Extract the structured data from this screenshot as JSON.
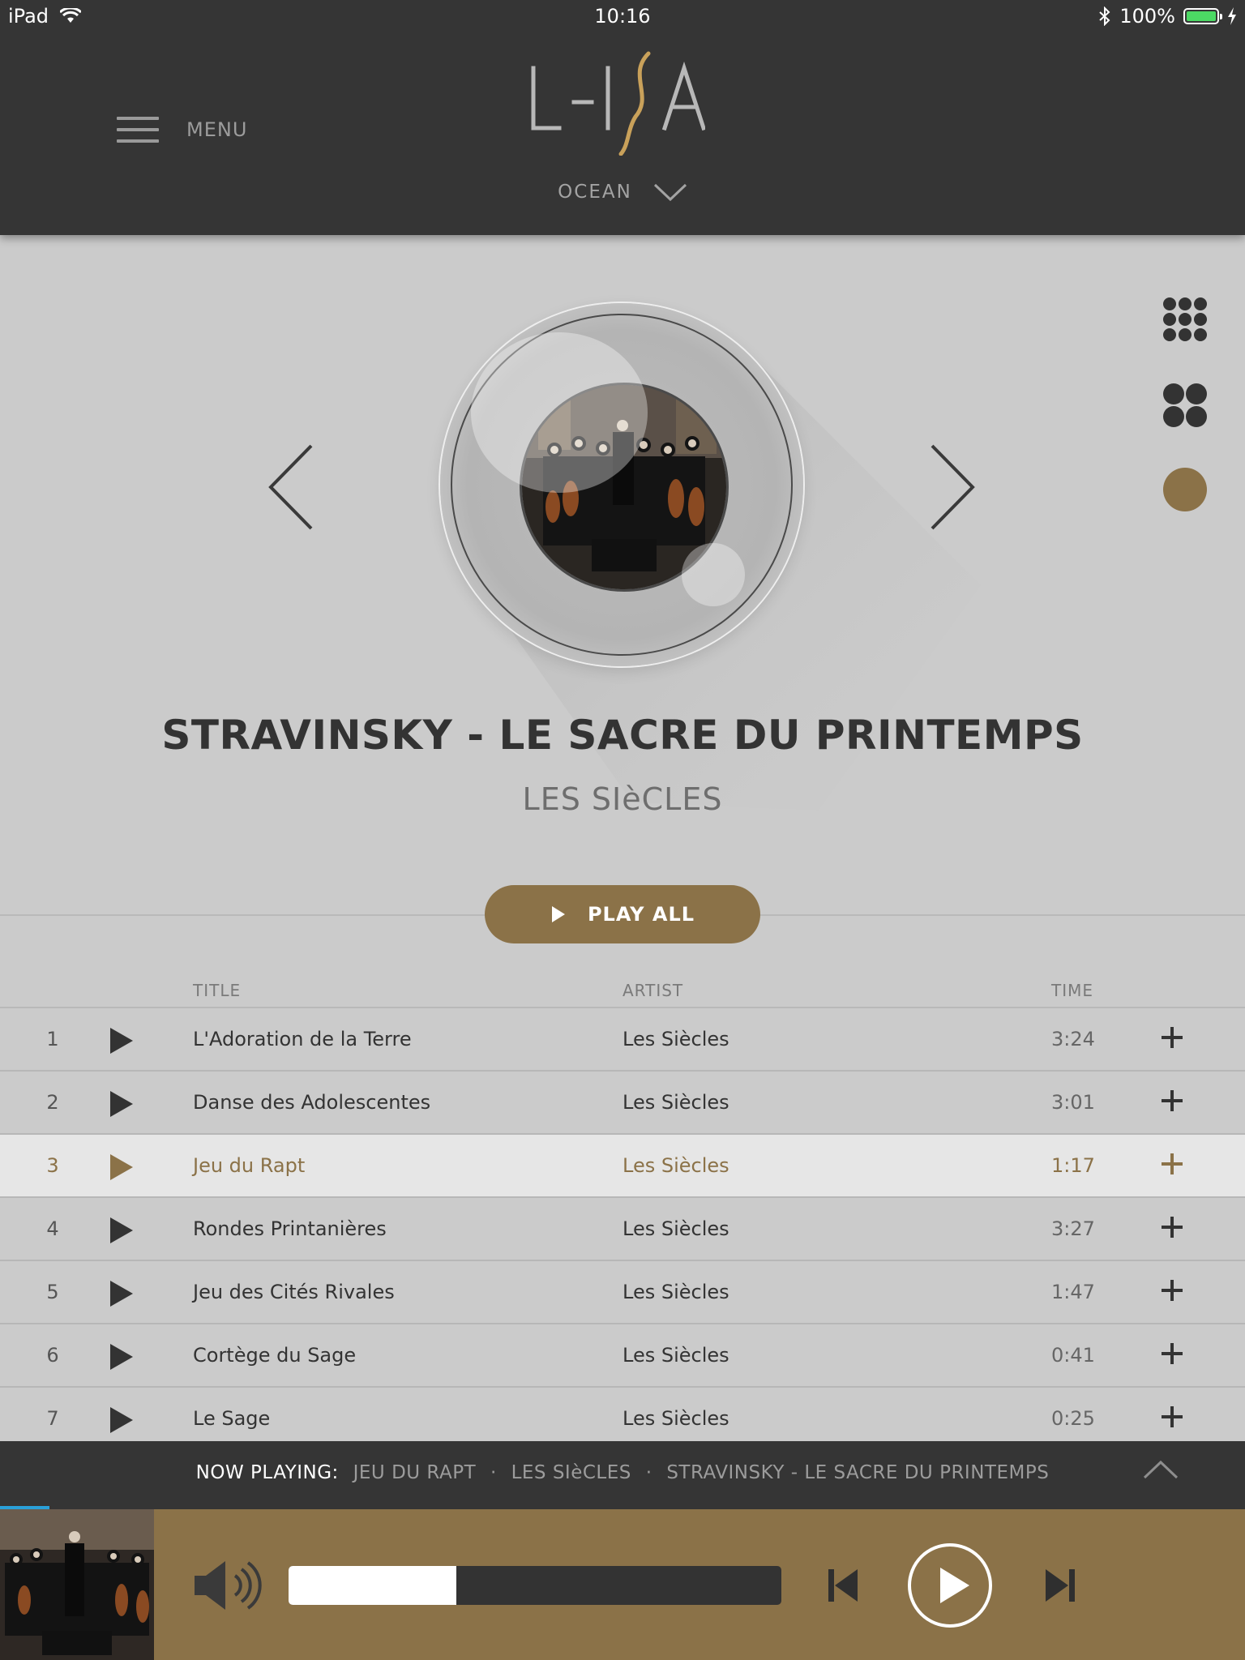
{
  "status_bar": {
    "device": "iPad",
    "time": "10:16",
    "battery": "100%"
  },
  "header": {
    "menu_label": "MENU",
    "logo_text": "L-ISA",
    "zone": "OCEAN"
  },
  "album": {
    "title": "STRAVINSKY - LE SACRE DU PRINTEMPS",
    "artist": "LES SIèCLES",
    "play_all_label": "PLAY ALL"
  },
  "table": {
    "columns": {
      "title": "TITLE",
      "artist": "ARTIST",
      "time": "TIME"
    },
    "active_track": 3,
    "tracks": [
      {
        "num": "1",
        "title": "L'Adoration de la Terre",
        "artist": "Les Siècles",
        "time": "3:24"
      },
      {
        "num": "2",
        "title": "Danse des Adolescentes",
        "artist": "Les Siècles",
        "time": "3:01"
      },
      {
        "num": "3",
        "title": "Jeu du Rapt",
        "artist": "Les Siècles",
        "time": "1:17"
      },
      {
        "num": "4",
        "title": "Rondes Printanières",
        "artist": "Les Siècles",
        "time": "3:27"
      },
      {
        "num": "5",
        "title": "Jeu des Cités Rivales",
        "artist": "Les Siècles",
        "time": "1:47"
      },
      {
        "num": "6",
        "title": "Cortège du Sage",
        "artist": "Les Siècles",
        "time": "0:41"
      },
      {
        "num": "7",
        "title": "Le Sage",
        "artist": "Les Siècles",
        "time": "0:25"
      }
    ]
  },
  "now_playing": {
    "label": "NOW PLAYING:",
    "track": "JEU DU RAPT",
    "artist": "LES SIèCLES",
    "album": "STRAVINSKY - LE SACRE DU PRINTEMPS",
    "track_progress": 0.04
  },
  "player": {
    "volume_level": 0.34
  },
  "colors": {
    "accent": "#8b7248",
    "header_bg": "#353535",
    "page_bg": "#cbcbcb",
    "active_row_bg": "#e6e6e6",
    "progress_blue": "#2aa0d8"
  },
  "icons": {
    "menu": "hamburger-icon",
    "zone_dropdown": "chevron-down-icon",
    "prev_album": "chevron-left-icon",
    "next_album": "chevron-right-icon",
    "grid_large": "grid-9-dots-icon",
    "grid_medium": "grid-4-dots-icon",
    "grid_single": "single-dot-icon",
    "play": "play-icon",
    "add": "plus-icon",
    "volume": "speaker-icon",
    "previous": "skip-previous-icon",
    "next": "skip-next-icon",
    "expand": "chevron-up-icon"
  }
}
